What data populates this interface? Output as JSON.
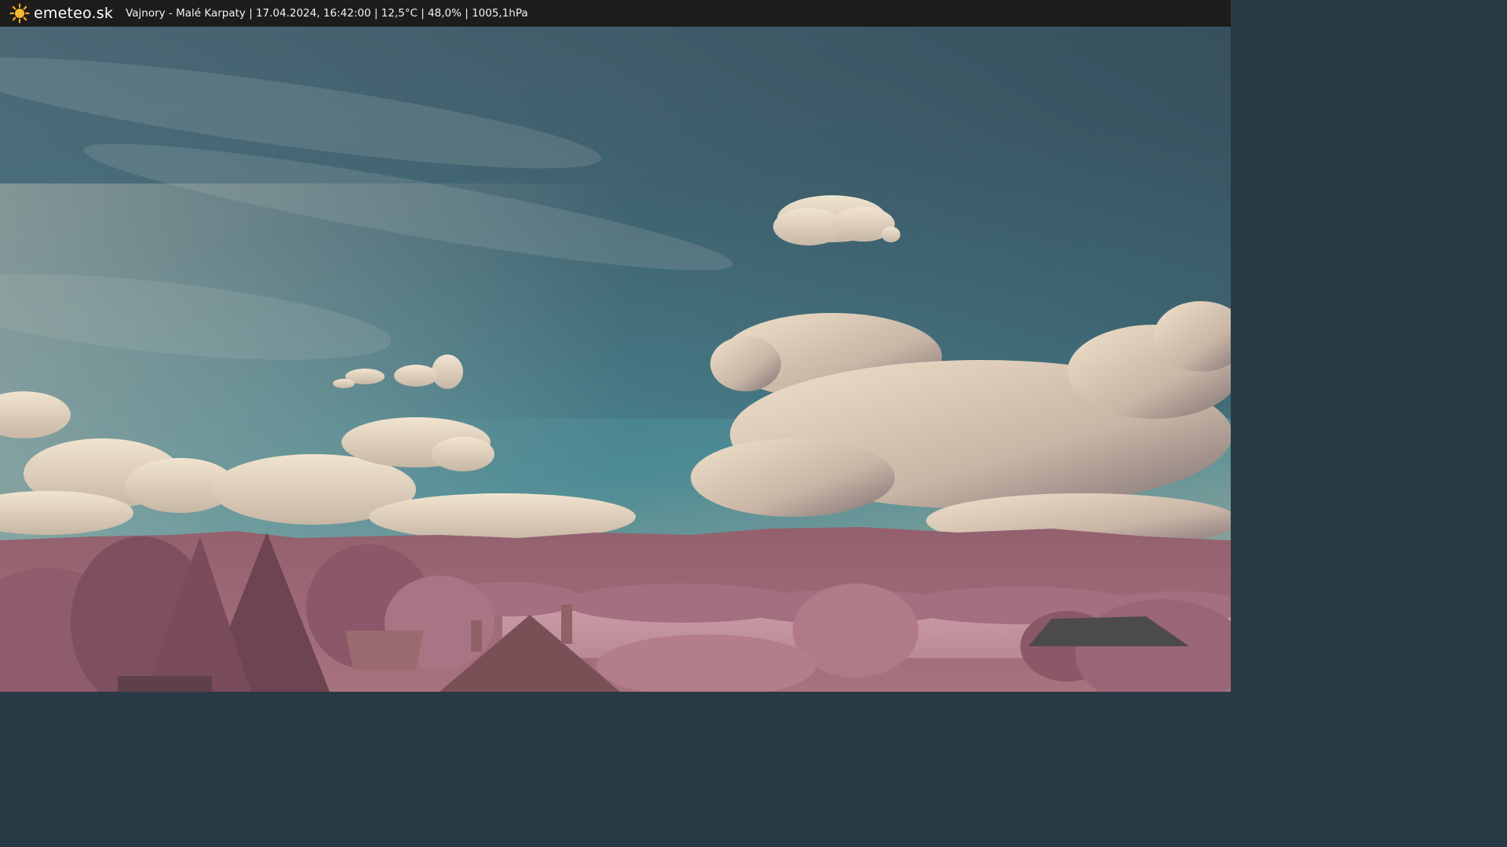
{
  "header": {
    "logo_icon": "sun-icon",
    "brand": "emeteo.sk",
    "status_text": "Vajnory - Malé Karpaty | 17.04.2024, 16:42:00 | 12,5°C | 48,0% | 1005,1hPa"
  },
  "colors": {
    "bar_background": "#1c1c1c",
    "sun_accent": "#f5a623",
    "sky_top": "#3b5563",
    "sky_bottom": "#4a8a95",
    "cloud": "#e8d9c4",
    "hills": "#8a5d6a",
    "foliage": "#a06a7b"
  }
}
